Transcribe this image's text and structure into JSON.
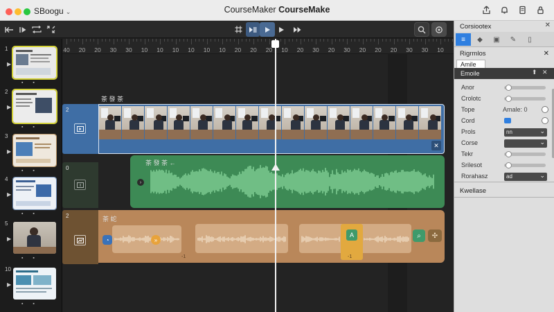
{
  "window": {
    "app_menu": "SBoogu",
    "title_part1": "CourseMaker",
    "title_part2": "CourseMake"
  },
  "title_icons": [
    "upload-icon",
    "bell-icon",
    "document-icon",
    "lock-icon"
  ],
  "toolbar": {
    "left_buttons": [
      "back-to-start-icon",
      "step-forward-icon",
      "loop-icon",
      "fullscreen-icon"
    ],
    "transport": [
      "frame-icon",
      "play-pause-icon",
      "stop-icon"
    ],
    "play_icon": "play-icon",
    "fast_forward_icon": "fast-forward-icon",
    "search_icon": "search-icon",
    "target_icon": "target-icon"
  },
  "slides": [
    {
      "num": "1",
      "selected": true
    },
    {
      "num": "2",
      "selected": true
    },
    {
      "num": "3",
      "selected": false
    },
    {
      "num": "4",
      "selected": false
    },
    {
      "num": "5",
      "selected": false
    },
    {
      "num": "10",
      "selected": false
    }
  ],
  "ruler": {
    "labels": [
      "40",
      "20",
      "20",
      "30",
      "30",
      "10",
      "10",
      "10",
      "10",
      "10",
      "10",
      "20",
      "20",
      "20",
      "10",
      "20",
      "30",
      "20",
      "30",
      "20",
      "20",
      "20",
      "30",
      "30",
      "10"
    ]
  },
  "tracks": {
    "video": {
      "num": "2",
      "label": "茶 發 茶",
      "close": "✕"
    },
    "audio": {
      "num": "0",
      "label": "茶 發 茶 ←"
    },
    "interactions": {
      "num": "2",
      "label": "茶 蛇",
      "marker": "-1"
    }
  },
  "inspector": {
    "title": "Corsiootex",
    "section1": "Rigrmlos",
    "sub_tab": "Amile",
    "header_label": "Emoile",
    "rows": [
      {
        "label": "Anor",
        "kind": "slider"
      },
      {
        "label": "Crolotc",
        "kind": "slider"
      },
      {
        "label": "Tope",
        "kind": "text",
        "value": "Amale: 0"
      },
      {
        "label": "Cord",
        "kind": "toggle"
      },
      {
        "label": "Prols",
        "kind": "dropdown",
        "value": "nn"
      },
      {
        "label": "Corse",
        "kind": "dropdown",
        "value": ""
      },
      {
        "label": "Tekr",
        "kind": "slider"
      },
      {
        "label": "Srilesot",
        "kind": "slider"
      },
      {
        "label": "Rorahasz",
        "kind": "dropdown",
        "value": "ad"
      }
    ],
    "section2": "Kwellase"
  }
}
